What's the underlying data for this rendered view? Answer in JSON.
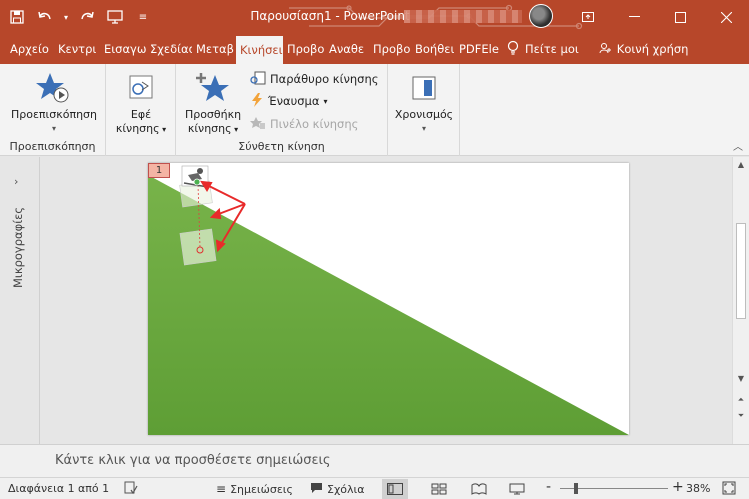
{
  "titlebar": {
    "title": "Παρουσίαση1  -  PowerPoint",
    "accent": "#b7472a"
  },
  "tabs": [
    {
      "label": "Αρχείο",
      "active": false
    },
    {
      "label": "Κεντρι",
      "active": false
    },
    {
      "label": "Εισαγω",
      "active": false
    },
    {
      "label": "Σχεδίασ",
      "active": false
    },
    {
      "label": "Μεταβ",
      "active": false
    },
    {
      "label": "Κινήσει",
      "active": true
    },
    {
      "label": "Προβο",
      "active": false
    },
    {
      "label": "Αναθε",
      "active": false
    },
    {
      "label": "Προβο",
      "active": false
    },
    {
      "label": "Βοήθει",
      "active": false
    },
    {
      "label": "PDFEle",
      "active": false
    }
  ],
  "tab_right": {
    "tell_me": "Πείτε μοι",
    "share": "Κοινή χρήση"
  },
  "ribbon": {
    "preview": {
      "label": "Προεπισκόπηση",
      "group_label": "Προεπισκόπηση"
    },
    "effects": {
      "label_line1": "Εφέ",
      "label_line2": "κίνησης"
    },
    "add_animation": {
      "label_line1": "Προσθήκη",
      "label_line2": "κίνησης"
    },
    "animation_pane": "Παράθυρο κίνησης",
    "trigger": "Έναυσμα",
    "animation_painter": "Πινέλο κίνησης",
    "advanced_group_label": "Σύνθετη κίνηση",
    "timing": "Χρονισμός"
  },
  "thumbnails": {
    "label": "Μικρογραφίες"
  },
  "slide": {
    "animation_tag": "1",
    "green": "#6aa83f"
  },
  "notes": {
    "placeholder": "Κάντε κλικ για να προσθέσετε σημειώσεις"
  },
  "status": {
    "slide_counter": "Διαφάνεια 1 από 1",
    "notes_btn": "Σημειώσεις",
    "comments_btn": "Σχόλια",
    "zoom_minus": "-",
    "zoom_plus": "+",
    "zoom": "38%"
  }
}
